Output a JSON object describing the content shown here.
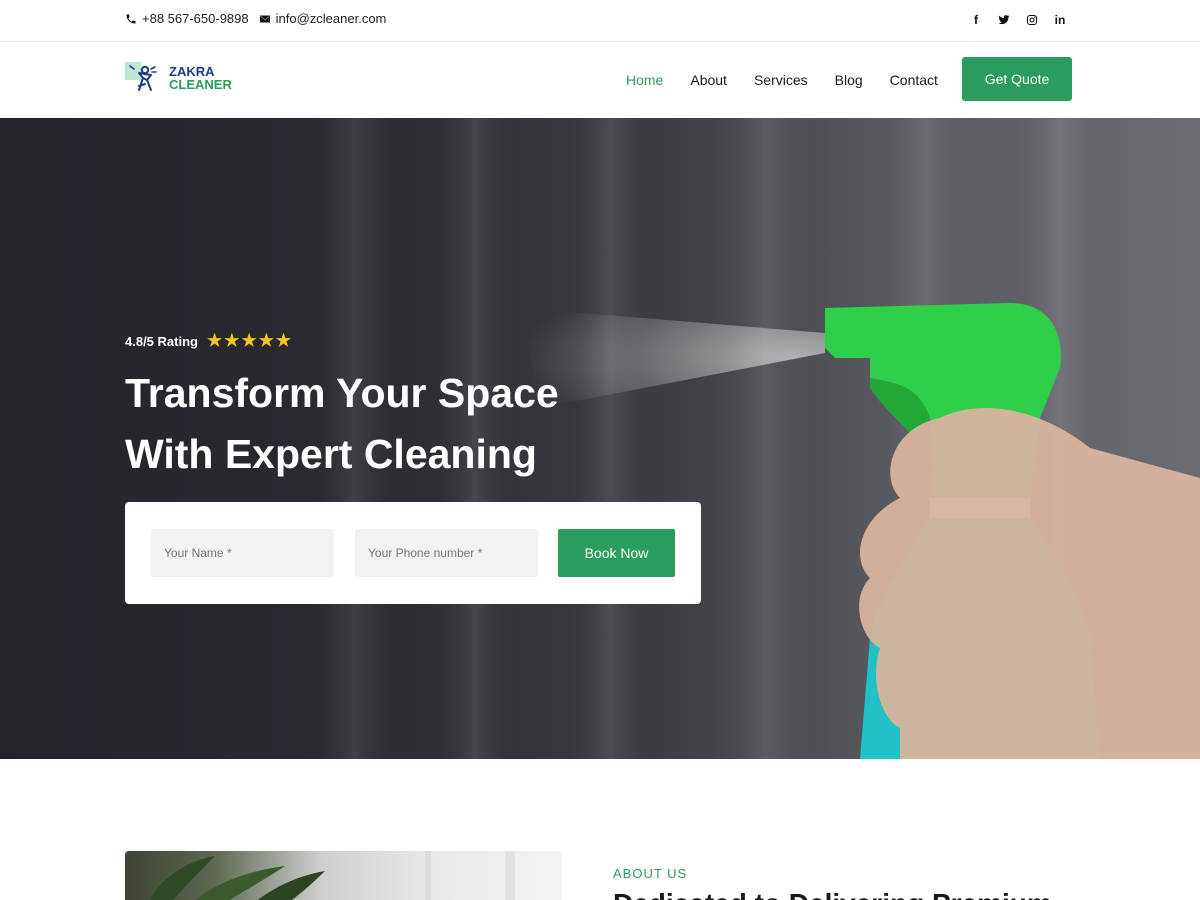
{
  "topbar": {
    "phone": "+88 567-650-9898",
    "email": "info@zcleaner.com",
    "social": [
      "facebook-icon",
      "twitter-icon",
      "instagram-icon",
      "linkedin-icon"
    ]
  },
  "logo": {
    "line1": "ZAKRA",
    "line2": "CLEANER"
  },
  "nav": {
    "items": [
      {
        "label": "Home",
        "active": true
      },
      {
        "label": "About",
        "active": false
      },
      {
        "label": "Services",
        "active": false
      },
      {
        "label": "Blog",
        "active": false
      },
      {
        "label": "Contact",
        "active": false
      }
    ],
    "cta": "Get Quote"
  },
  "hero": {
    "rating_text": "4.8/5 Rating",
    "rating_stars": 5,
    "title_line1": "Transform Your Space",
    "title_line2": "With Expert Cleaning",
    "form": {
      "name_placeholder": "Your Name *",
      "phone_placeholder": "Your Phone number *",
      "submit": "Book Now"
    }
  },
  "about": {
    "tag": "ABOUT US",
    "heading": "Dedicated to Delivering Premium"
  },
  "colors": {
    "brand_green": "#2a9d5c",
    "brand_blue": "#1f3a8a",
    "star": "#f5c518"
  }
}
